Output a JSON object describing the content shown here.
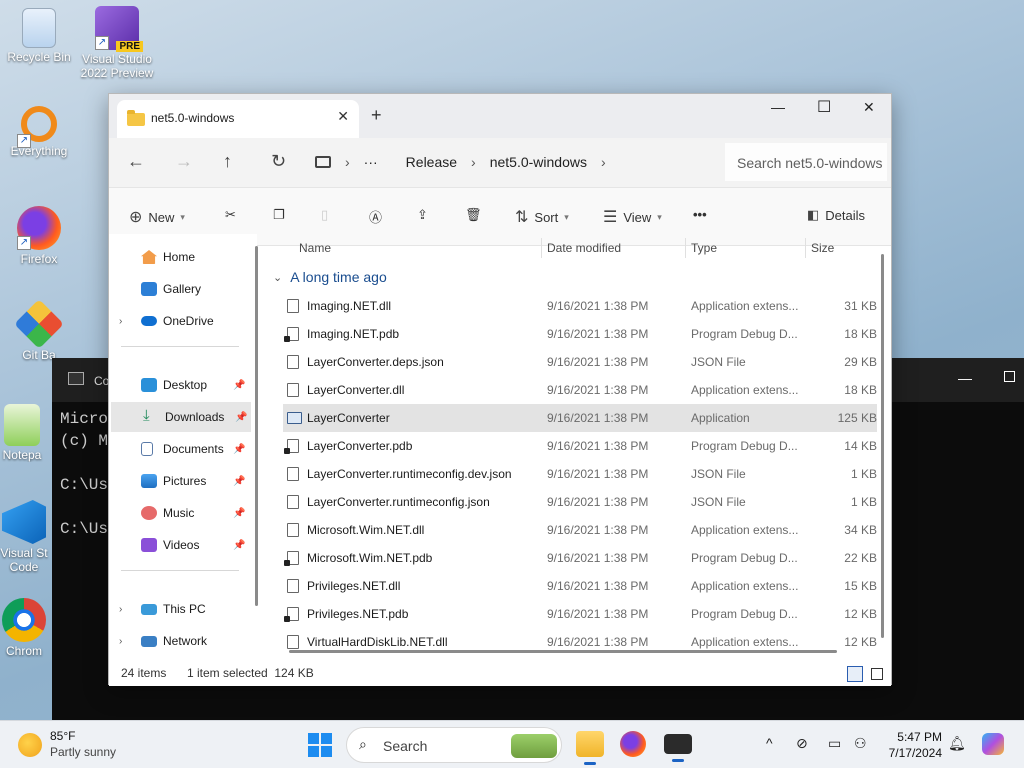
{
  "desktop": {
    "icons": [
      {
        "label": "Recycle Bin"
      },
      {
        "label": "Visual Studio 2022 Preview",
        "badge": "PRE"
      },
      {
        "label": "Everything"
      },
      {
        "label": "Firefox"
      },
      {
        "label": "Git Ba"
      },
      {
        "label": "Notepa"
      },
      {
        "label": "Visual St Code"
      },
      {
        "label": "Chrom"
      }
    ]
  },
  "console": {
    "title": "Co",
    "lines": [
      "Micros",
      "(c) Mi",
      "",
      "C:\\Use",
      "",
      "C:\\Use"
    ]
  },
  "explorer": {
    "tab_title": "net5.0-windows",
    "window_controls": {
      "minimize": "—",
      "maximize": "☐",
      "close": "✕"
    },
    "breadcrumb": [
      "Release",
      "net5.0-windows"
    ],
    "search_placeholder": "Search net5.0-windows",
    "toolbar": {
      "new": "New",
      "sort": "Sort",
      "view": "View",
      "more": "•••",
      "details": "Details"
    },
    "sidebar": {
      "items": [
        {
          "label": "Home"
        },
        {
          "label": "Gallery"
        },
        {
          "label": "OneDrive"
        },
        {
          "label": "Desktop"
        },
        {
          "label": "Downloads"
        },
        {
          "label": "Documents"
        },
        {
          "label": "Pictures"
        },
        {
          "label": "Music"
        },
        {
          "label": "Videos"
        },
        {
          "label": "This PC"
        },
        {
          "label": "Network"
        }
      ]
    },
    "columns": {
      "name": "Name",
      "date": "Date modified",
      "type": "Type",
      "size": "Size"
    },
    "group_label": "A long time ago",
    "files": [
      {
        "name": "Imaging.NET.dll",
        "date": "9/16/2021 1:38 PM",
        "type": "Application extens...",
        "size": "31 KB",
        "kind": "file"
      },
      {
        "name": "Imaging.NET.pdb",
        "date": "9/16/2021 1:38 PM",
        "type": "Program Debug D...",
        "size": "18 KB",
        "kind": "pdb"
      },
      {
        "name": "LayerConverter.deps.json",
        "date": "9/16/2021 1:38 PM",
        "type": "JSON File",
        "size": "29 KB",
        "kind": "file"
      },
      {
        "name": "LayerConverter.dll",
        "date": "9/16/2021 1:38 PM",
        "type": "Application extens...",
        "size": "18 KB",
        "kind": "file"
      },
      {
        "name": "LayerConverter",
        "date": "9/16/2021 1:38 PM",
        "type": "Application",
        "size": "125 KB",
        "kind": "app",
        "selected": true
      },
      {
        "name": "LayerConverter.pdb",
        "date": "9/16/2021 1:38 PM",
        "type": "Program Debug D...",
        "size": "14 KB",
        "kind": "pdb"
      },
      {
        "name": "LayerConverter.runtimeconfig.dev.json",
        "date": "9/16/2021 1:38 PM",
        "type": "JSON File",
        "size": "1 KB",
        "kind": "file"
      },
      {
        "name": "LayerConverter.runtimeconfig.json",
        "date": "9/16/2021 1:38 PM",
        "type": "JSON File",
        "size": "1 KB",
        "kind": "file"
      },
      {
        "name": "Microsoft.Wim.NET.dll",
        "date": "9/16/2021 1:38 PM",
        "type": "Application extens...",
        "size": "34 KB",
        "kind": "file"
      },
      {
        "name": "Microsoft.Wim.NET.pdb",
        "date": "9/16/2021 1:38 PM",
        "type": "Program Debug D...",
        "size": "22 KB",
        "kind": "pdb"
      },
      {
        "name": "Privileges.NET.dll",
        "date": "9/16/2021 1:38 PM",
        "type": "Application extens...",
        "size": "15 KB",
        "kind": "file"
      },
      {
        "name": "Privileges.NET.pdb",
        "date": "9/16/2021 1:38 PM",
        "type": "Program Debug D...",
        "size": "12 KB",
        "kind": "pdb"
      },
      {
        "name": "VirtualHardDiskLib.NET.dll",
        "date": "9/16/2021 1:38 PM",
        "type": "Application extens...",
        "size": "12 KB",
        "kind": "file"
      }
    ],
    "status": {
      "count": "24 items",
      "selection": "1 item selected  124 KB"
    }
  },
  "taskbar": {
    "weather_temp": "85°F",
    "weather_desc": "Partly sunny",
    "search_placeholder": "Search",
    "time": "5:47 PM",
    "date": "7/17/2024"
  }
}
